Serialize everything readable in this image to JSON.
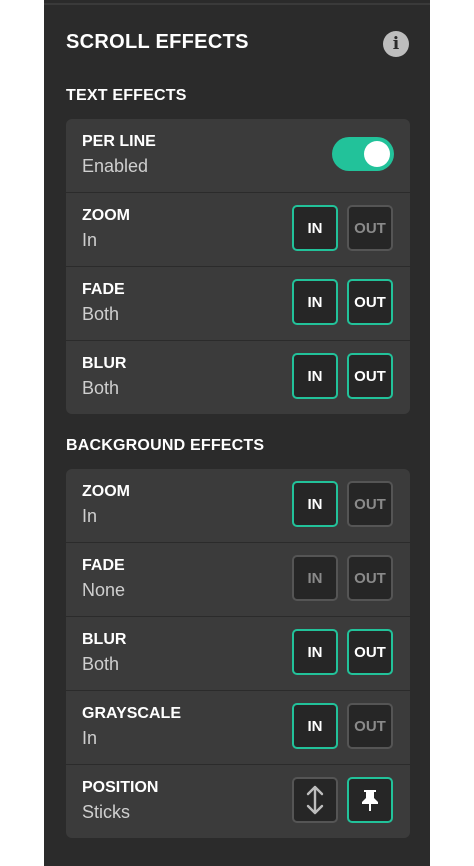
{
  "title": "SCROLL EFFECTS",
  "text_effects": {
    "heading": "TEXT EFFECTS",
    "per_line": {
      "label": "PER LINE",
      "value": "Enabled",
      "enabled": true
    },
    "rows": [
      {
        "label": "ZOOM",
        "value": "In",
        "in_label": "IN",
        "out_label": "OUT",
        "in_active": true,
        "out_active": false
      },
      {
        "label": "FADE",
        "value": "Both",
        "in_label": "IN",
        "out_label": "OUT",
        "in_active": true,
        "out_active": true
      },
      {
        "label": "BLUR",
        "value": "Both",
        "in_label": "IN",
        "out_label": "OUT",
        "in_active": true,
        "out_active": true
      }
    ]
  },
  "background_effects": {
    "heading": "BACKGROUND EFFECTS",
    "rows": [
      {
        "label": "ZOOM",
        "value": "In",
        "in_label": "IN",
        "out_label": "OUT",
        "in_active": true,
        "out_active": false
      },
      {
        "label": "FADE",
        "value": "None",
        "in_label": "IN",
        "out_label": "OUT",
        "in_active": false,
        "out_active": false
      },
      {
        "label": "BLUR",
        "value": "Both",
        "in_label": "IN",
        "out_label": "OUT",
        "in_active": true,
        "out_active": true
      },
      {
        "label": "GRAYSCALE",
        "value": "In",
        "in_label": "IN",
        "out_label": "OUT",
        "in_active": true,
        "out_active": false
      }
    ],
    "position": {
      "label": "POSITION",
      "value": "Sticks",
      "scroll_icon": "vertical-arrows-icon",
      "stick_icon": "pin-icon",
      "stick_active": true
    }
  },
  "colors": {
    "accent": "#22c29a",
    "panel": "#2b2b2b",
    "row": "#3b3b3b"
  }
}
